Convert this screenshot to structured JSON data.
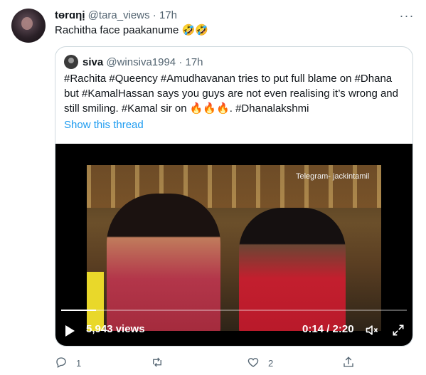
{
  "tweet": {
    "display_name": "tɵrɑηị",
    "handle": "@tara_views",
    "separator": "·",
    "time": "17h",
    "text": "Rachitha face paakanume 🤣🤣"
  },
  "quoted": {
    "display_name": "siva",
    "handle": "@winsiva1994",
    "separator": "·",
    "time": "17h",
    "text": "#Rachita #Queency #Amudhavanan tries to put full blame on #Dhana but #KamalHassan says you guys are not even realising it’s wrong and still smiling. #Kamal sir on 🔥🔥🔥. #Dhanalakshmi",
    "show_thread": "Show this thread"
  },
  "video": {
    "watermark": "Telegram- jackintamil",
    "views": "5,943 views",
    "time": "0:14 / 2:20",
    "progress": 0.1
  },
  "actions": {
    "reply_count": "1",
    "retweet_count": "",
    "like_count": "2"
  }
}
